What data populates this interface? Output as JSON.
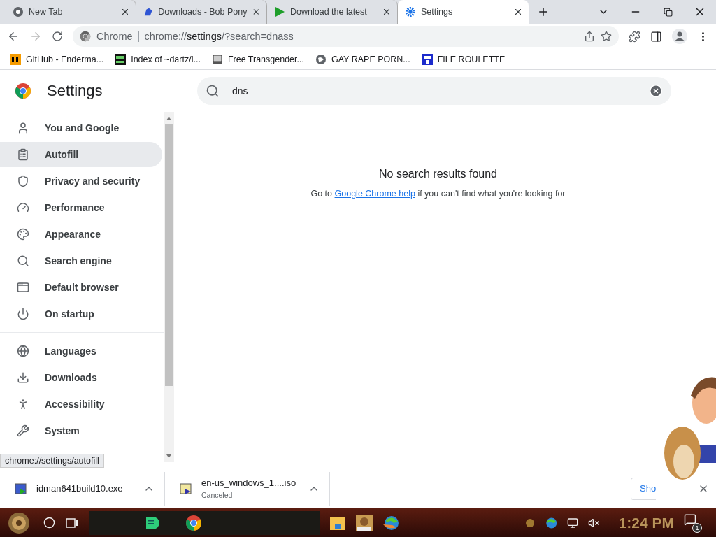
{
  "tabs": [
    {
      "title": "New Tab",
      "selected": false
    },
    {
      "title": "Downloads - Bob Pony",
      "selected": false
    },
    {
      "title": "Download the latest",
      "selected": false
    },
    {
      "title": "Settings",
      "selected": true
    }
  ],
  "toolbar": {
    "site_label": "Chrome",
    "url": "chrome://**settings**/?search=dnass"
  },
  "bookmarks": [
    {
      "title": "GitHub - Enderma..."
    },
    {
      "title": "Index of ~dartz/i..."
    },
    {
      "title": "Free Transgender..."
    },
    {
      "title": "GAY RAPE PORN..."
    },
    {
      "title": "FILE ROULETTE"
    }
  ],
  "settings": {
    "title": "Settings",
    "search": {
      "value": "dns"
    },
    "sidebar": {
      "groups": [
        [
          {
            "label": "You and Google",
            "selected": false
          },
          {
            "label": "Autofill",
            "selected": true
          },
          {
            "label": "Privacy and security",
            "selected": false
          },
          {
            "label": "Performance",
            "selected": false
          },
          {
            "label": "Appearance",
            "selected": false
          },
          {
            "label": "Search engine",
            "selected": false
          },
          {
            "label": "Default browser",
            "selected": false
          },
          {
            "label": "On startup",
            "selected": false
          }
        ],
        [
          {
            "label": "Languages",
            "selected": false
          },
          {
            "label": "Downloads",
            "selected": false
          },
          {
            "label": "Accessibility",
            "selected": false
          },
          {
            "label": "System",
            "selected": false
          }
        ]
      ]
    },
    "results": {
      "heading": "No search results found",
      "help_before": "Go to",
      "help_link": "Google Chrome help",
      "help_after": "if you can't find what you're looking for"
    }
  },
  "status_bubble": "chrome://settings/autofill",
  "downloads": {
    "items": [
      {
        "name": "idman641build10.exe"
      },
      {
        "name": "en-us_windows_1....iso",
        "status": "Canceled"
      }
    ],
    "show_all": "Sho"
  },
  "taskbar": {
    "clock": "1:24 PM",
    "notification_count": "1"
  }
}
